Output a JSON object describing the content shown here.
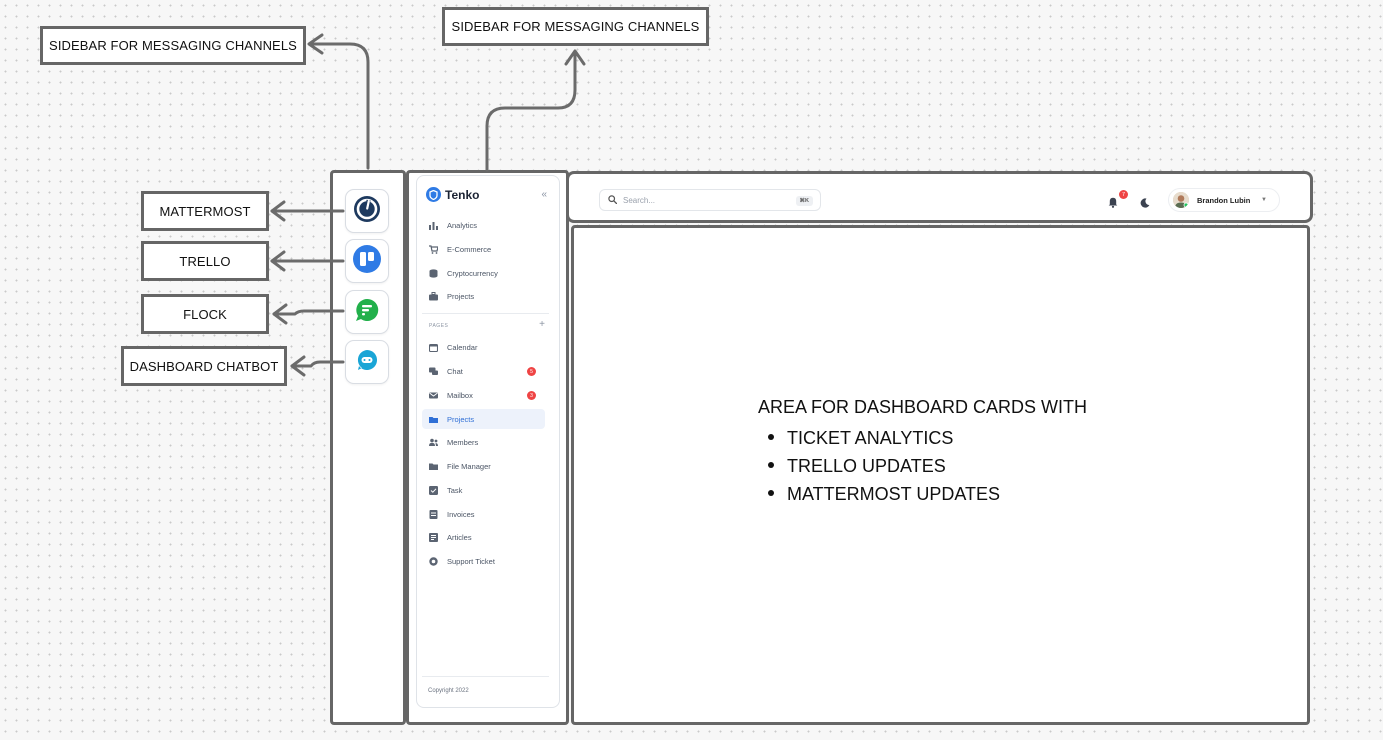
{
  "annotations": {
    "sidebar_left": "SIDEBAR FOR MESSAGING CHANNELS",
    "sidebar_top": "SIDEBAR FOR MESSAGING CHANNELS",
    "mattermost": "MATTERMOST",
    "trello": "TRELLO",
    "flock": "FLOCK",
    "chatbot": "DASHBOARD CHATBOT"
  },
  "channels": [
    {
      "name": "mattermost",
      "icon": "mattermost-icon",
      "color": "#1e3a5f"
    },
    {
      "name": "trello",
      "icon": "trello-icon",
      "color": "#2f7be5"
    },
    {
      "name": "flock",
      "icon": "flock-icon",
      "color": "#22b04b"
    },
    {
      "name": "chatbot",
      "icon": "chatbot-icon",
      "color": "#1aa5d6"
    }
  ],
  "sidebar": {
    "brand": "Tenko",
    "collapse": "«",
    "items": [
      {
        "label": "Analytics",
        "icon": "chart-icon"
      },
      {
        "label": "E-Commerce",
        "icon": "cart-icon"
      },
      {
        "label": "Cryptocurrency",
        "icon": "coins-icon"
      },
      {
        "label": "Projects",
        "icon": "briefcase-icon"
      }
    ],
    "section_label": "PAGES",
    "section_plus": "+",
    "pages": [
      {
        "label": "Calendar",
        "icon": "calendar-icon"
      },
      {
        "label": "Chat",
        "icon": "chat-icon",
        "badge": "5"
      },
      {
        "label": "Mailbox",
        "icon": "mail-icon",
        "badge": "3"
      },
      {
        "label": "Projects",
        "icon": "folder-icon",
        "active": true
      },
      {
        "label": "Members",
        "icon": "users-icon"
      },
      {
        "label": "File Manager",
        "icon": "folder-icon"
      },
      {
        "label": "Task",
        "icon": "task-icon"
      },
      {
        "label": "Invoices",
        "icon": "invoice-icon"
      },
      {
        "label": "Articles",
        "icon": "article-icon"
      },
      {
        "label": "Support Ticket",
        "icon": "support-icon"
      }
    ],
    "copyright": "Copyright 2022"
  },
  "topbar": {
    "search_placeholder": "Search...",
    "search_shortcut": "⌘K",
    "notifications": "7",
    "user_name": "Brandon Lubin"
  },
  "content": {
    "heading": "AREA FOR DASHBOARD CARDS WITH",
    "items": [
      "TICKET ANALYTICS",
      "TRELLO UPDATES",
      "MATTERMOST UPDATES"
    ]
  },
  "colors": {
    "frame_border": "#666666",
    "accent": "#2f7be5",
    "badge": "#ef4444"
  }
}
